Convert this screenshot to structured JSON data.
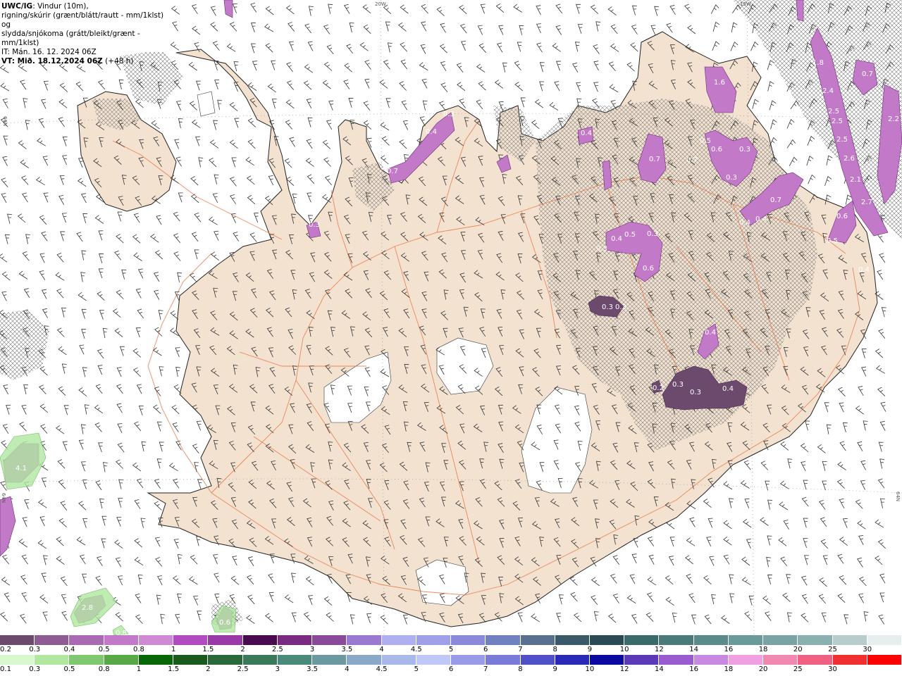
{
  "header": {
    "model": "UWC/IG",
    "line1_rest": ": Vindur (10m),",
    "line2": "rigning/skúrir (grænt/blátt/rautt - mm/1klst) og",
    "line3": "slydda/snjókoma (grátt/bleikt/grænt - mm/1klst)",
    "issue_time": "IT: Mán. 16. 12. 2024 06Z",
    "valid_prefix": "VT: Mið. 18.12.2024 06Z",
    "valid_suffix": "(+48 h)"
  },
  "coords": {
    "lon_20w": "20W",
    "lon_15w": "15W",
    "lat_66n": "66N",
    "lat_64n": "64N",
    "lat_64n_left": "64N"
  },
  "colors": {
    "land": "#f3e2d0",
    "roads": "#e8774a",
    "glacier": "#ffffff",
    "sea": "#ffffff",
    "coast": "#222222",
    "hatch": "#777777",
    "snow_light": "#b04cc0",
    "snow_dark": "#6a2e72"
  },
  "precip_labels": [
    {
      "name": "north-1",
      "text": "0.4"
    },
    {
      "name": "north-2",
      "text": "0.3"
    },
    {
      "name": "north-3",
      "text": "0.7"
    },
    {
      "name": "ne-1",
      "text": "1.6"
    },
    {
      "name": "ne-2",
      "text": "0.4"
    },
    {
      "name": "ne-3",
      "text": "0.7"
    },
    {
      "name": "ne-4",
      "text": "0.5"
    },
    {
      "name": "ne-5",
      "text": "0.6"
    },
    {
      "name": "ne-6",
      "text": "0.3"
    },
    {
      "name": "ne-7",
      "text": "0.3"
    },
    {
      "name": "ne-8",
      "text": "0.7"
    },
    {
      "name": "ne-9",
      "text": "0.4"
    },
    {
      "name": "ne-10",
      "text": "0.4"
    },
    {
      "name": "ne-11",
      "text": "0.7"
    },
    {
      "name": "east-1",
      "text": "0.6"
    },
    {
      "name": "east-2",
      "text": "0.5"
    },
    {
      "name": "east-3",
      "text": "0.4"
    },
    {
      "name": "central-1",
      "text": "0.5"
    },
    {
      "name": "central-2",
      "text": "0.3"
    },
    {
      "name": "central-3",
      "text": "0.4"
    },
    {
      "name": "central-4",
      "text": "0.3"
    },
    {
      "name": "central-5",
      "text": "0.6"
    },
    {
      "name": "central-6",
      "text": "0.3"
    },
    {
      "name": "central-7",
      "text": "0.3"
    },
    {
      "name": "central-8",
      "text": "0.4"
    },
    {
      "name": "se-1",
      "text": "0.2"
    },
    {
      "name": "se-2",
      "text": "0.3"
    },
    {
      "name": "se-3",
      "text": "0.3"
    },
    {
      "name": "se-4",
      "text": "0.4"
    },
    {
      "name": "west-1",
      "text": "0.3"
    },
    {
      "name": "sea-1",
      "text": "1.8"
    },
    {
      "name": "sea-2",
      "text": "2.4"
    },
    {
      "name": "sea-3",
      "text": "2.5"
    },
    {
      "name": "sea-4",
      "text": "2.5"
    },
    {
      "name": "sea-5",
      "text": "2.5"
    },
    {
      "name": "sea-6",
      "text": "2.6"
    },
    {
      "name": "sea-7",
      "text": "2.1"
    },
    {
      "name": "sea-8",
      "text": "2.7"
    },
    {
      "name": "sea-9",
      "text": "0.7"
    },
    {
      "name": "sea-10",
      "text": "2.2"
    },
    {
      "name": "sw-1",
      "text": "4.1"
    },
    {
      "name": "s-1",
      "text": "2.8"
    },
    {
      "name": "s-2",
      "text": "0.6"
    },
    {
      "name": "s-3",
      "text": "0.8"
    }
  ],
  "legend_snow": {
    "labels": [
      "0.2",
      "0.3",
      "0.4",
      "0.5",
      "0.8",
      "1",
      "1.5",
      "2",
      "2.5",
      "3",
      "3.5",
      "4",
      "4.5",
      "5",
      "6",
      "7",
      "8",
      "9",
      "10",
      "12",
      "14",
      "16",
      "18",
      "20",
      "25",
      "30"
    ],
    "colors": [
      "#6b4a6e",
      "#8e5c92",
      "#a86ab0",
      "#c27ac8",
      "#d08ad4",
      "#b04cc0",
      "#9a3aa8",
      "#4a0a4e",
      "#7a2a80",
      "#8a4a9a",
      "#9a7ad0",
      "#b0b0f0",
      "#a0a0e8",
      "#8a8ad8",
      "#7080c0",
      "#5a7090",
      "#3a5a6a",
      "#2a4a54",
      "#3a6a6a",
      "#4a7a7a",
      "#5a8a8a",
      "#6a9a9a",
      "#7aa4a4",
      "#8ab0b0",
      "#b8cccc",
      "#e8eeee"
    ]
  },
  "legend_rain": {
    "labels": [
      "0.1",
      "0.3",
      "0.5",
      "0.8",
      "1",
      "1.5",
      "2",
      "2.5",
      "3",
      "3.5",
      "4",
      "4.5",
      "5",
      "6",
      "7",
      "8",
      "9",
      "10",
      "12",
      "14",
      "16",
      "18",
      "20",
      "25",
      "30"
    ],
    "colors": [
      "#d8f8d0",
      "#b0e8a0",
      "#80c870",
      "#58a848",
      "#086808",
      "#1a5a1a",
      "#2a6a3a",
      "#3a7a5a",
      "#4a8a7a",
      "#6a9aa0",
      "#8aa8c8",
      "#a8b8e8",
      "#c0c8f8",
      "#9a9ae8",
      "#7a7ad8",
      "#5050c8",
      "#2a2ab8",
      "#0a0aa0",
      "#5a3ab8",
      "#9a5ad0",
      "#c88ae0",
      "#f0a0e0",
      "#f088b0",
      "#f06080",
      "#f03030",
      "#ff0000"
    ]
  }
}
